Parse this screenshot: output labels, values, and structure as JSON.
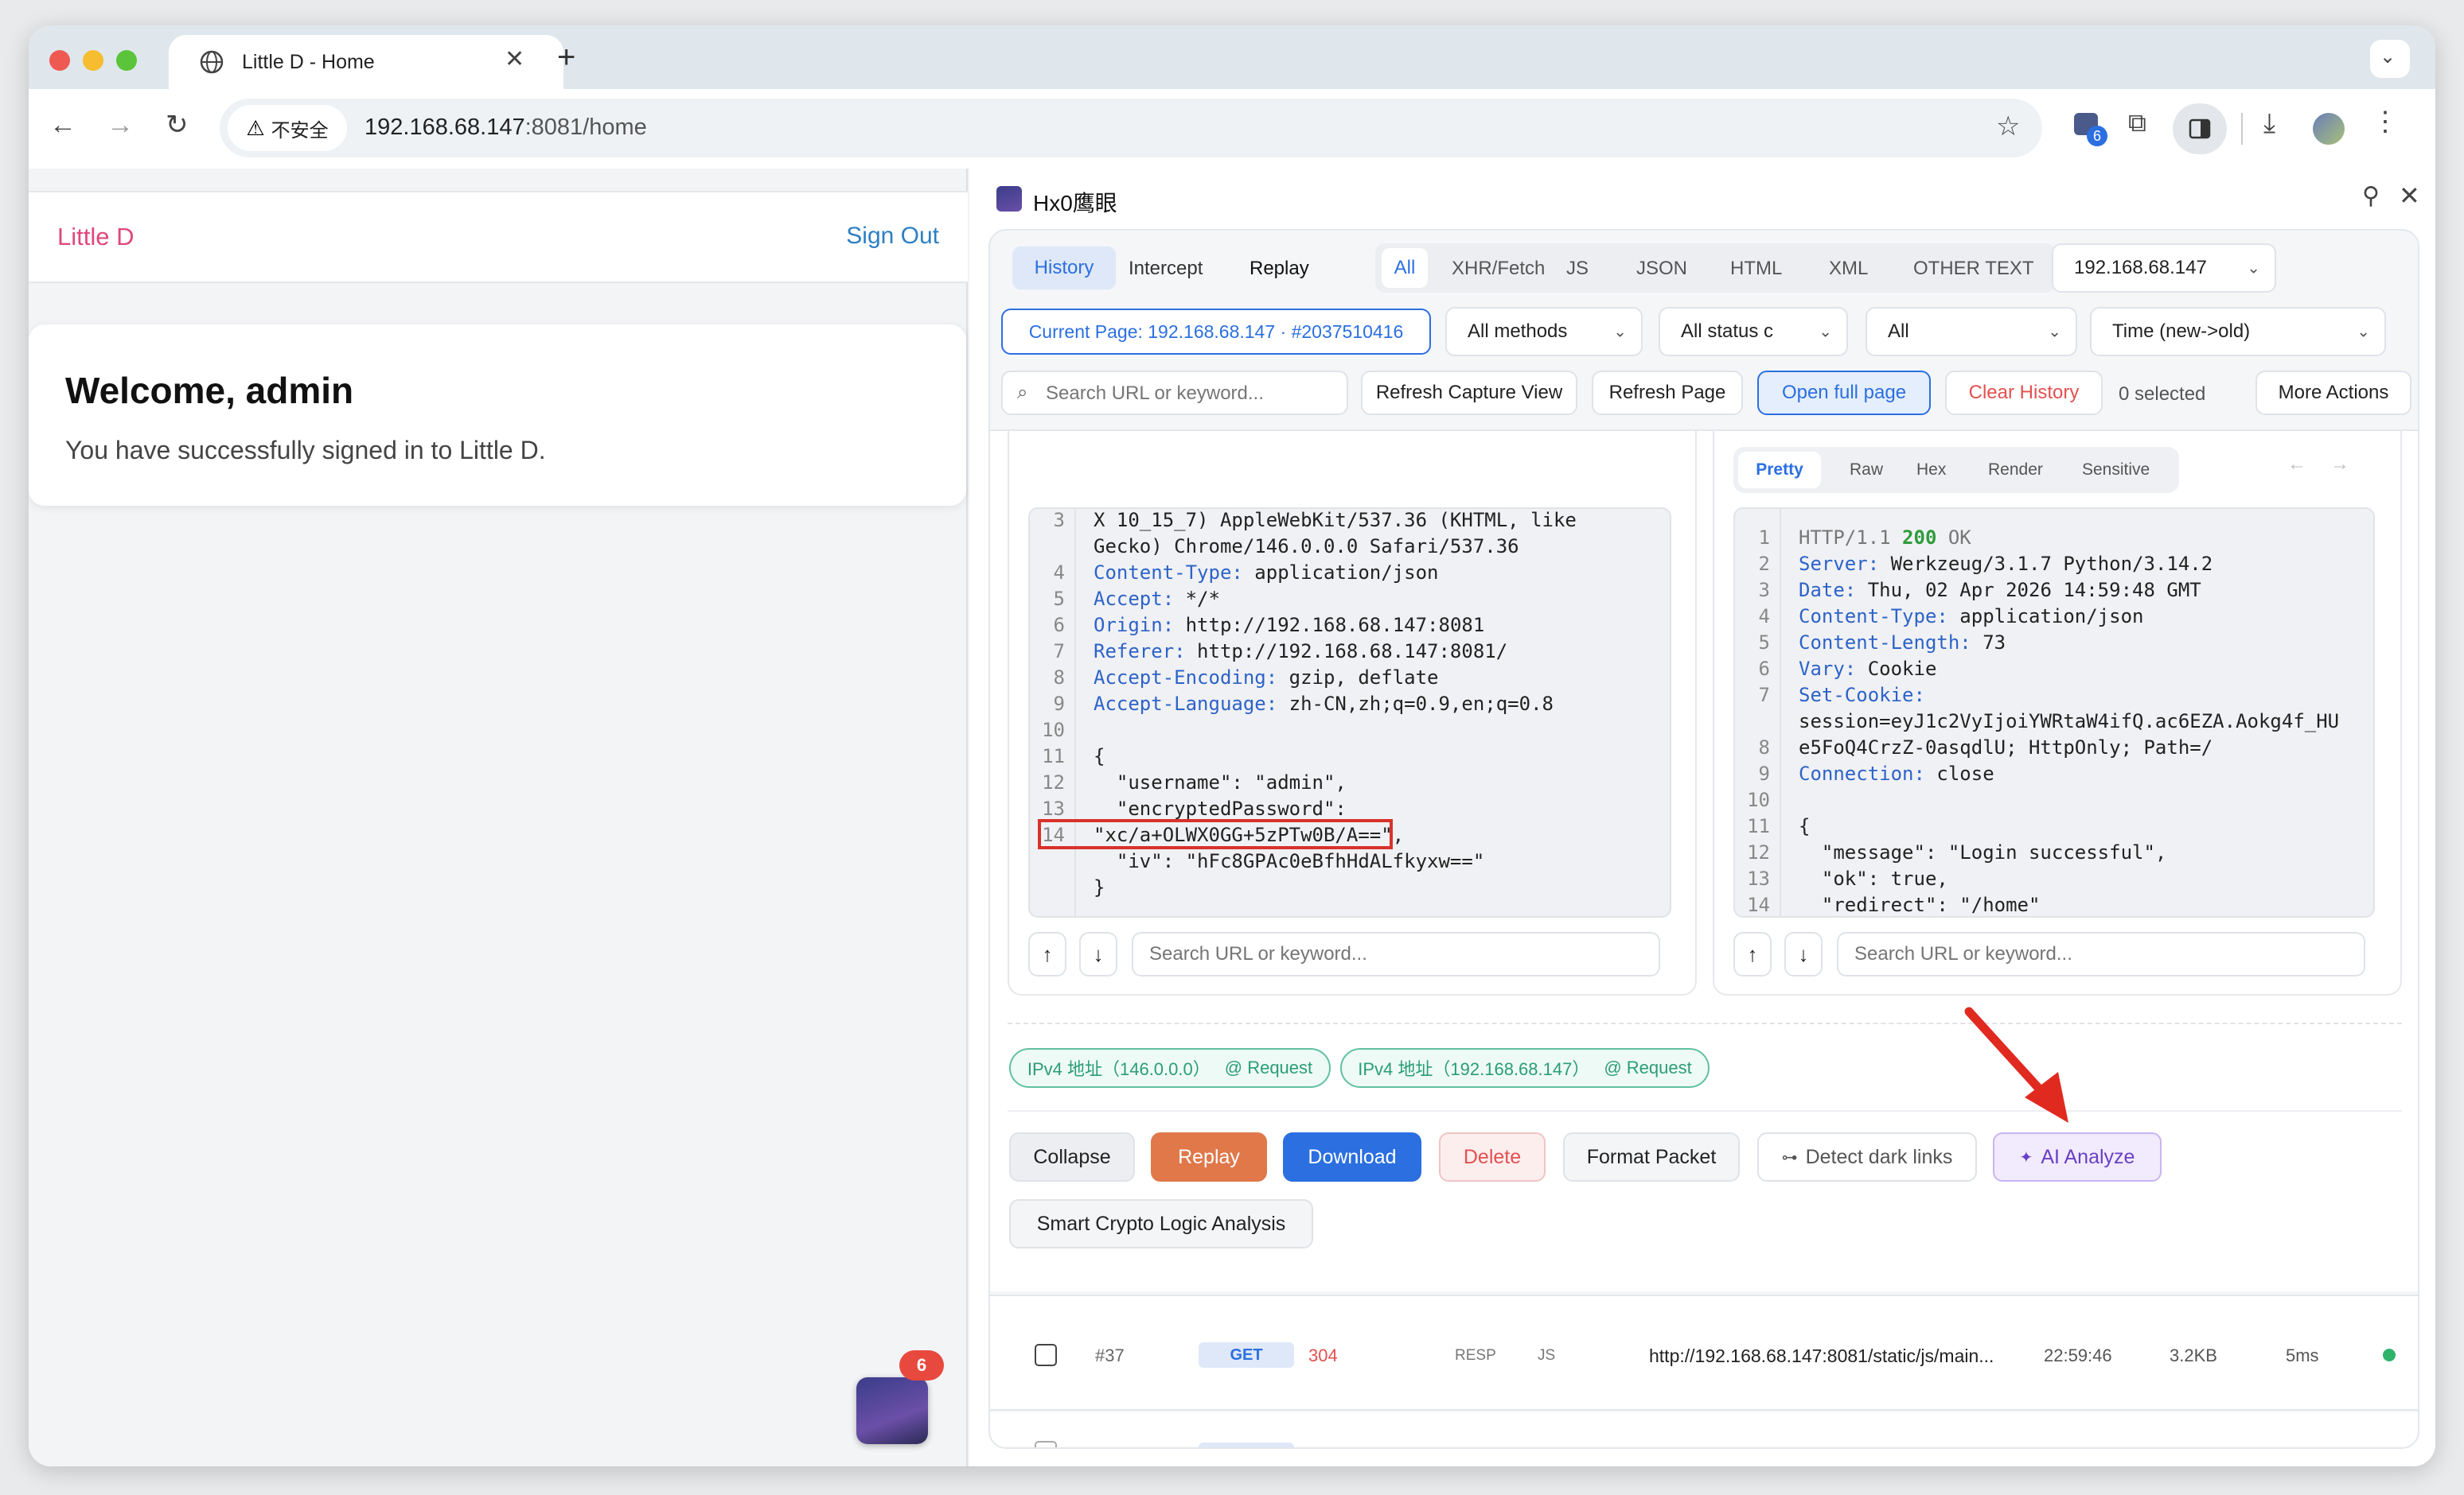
{
  "browser": {
    "tab_title": "Little D - Home",
    "new_tab": "+",
    "security_label": "不安全",
    "url_host": "192.168.68.147",
    "url_rest": ":8081/home",
    "ext_badge": "6"
  },
  "app": {
    "brand": "Little D",
    "sign_out": "Sign Out",
    "welcome_title": "Welcome, admin",
    "welcome_text": "You have successfully signed in to Little D.",
    "float_badge": "6"
  },
  "panel": {
    "title": "Hx0鹰眼",
    "mode_tabs": [
      "History",
      "Intercept",
      "Replay"
    ],
    "type_filters": [
      "All",
      "XHR/Fetch",
      "JS",
      "JSON",
      "HTML",
      "XML",
      "OTHER TEXT"
    ],
    "host_select": "192.168.68.147",
    "current_page": "Current Page: 192.168.68.147 · #2037510416",
    "methods_select": "All methods",
    "status_select": "All status c",
    "all_select": "All",
    "time_select": "Time (new->old)",
    "search_placeholder": "Search URL or keyword...",
    "refresh_capture": "Refresh Capture View",
    "refresh_page": "Refresh Page",
    "open_full_page": "Open full page",
    "clear_history": "Clear History",
    "selected_count": "0 selected",
    "more_actions": "More Actions"
  },
  "request_view": {
    "lines": [
      {
        "n": "3",
        "k": "",
        "v": "X 10_15_7) AppleWebKit/537.36 (KHTML, like"
      },
      {
        "n": "",
        "k": "",
        "v": "Gecko) Chrome/146.0.0.0 Safari/537.36"
      },
      {
        "n": "4",
        "k": "Content-Type:",
        "v": " application/json"
      },
      {
        "n": "5",
        "k": "Accept:",
        "v": " */*"
      },
      {
        "n": "6",
        "k": "Origin:",
        "v": " http://192.168.68.147:8081"
      },
      {
        "n": "7",
        "k": "Referer:",
        "v": " http://192.168.68.147:8081/"
      },
      {
        "n": "8",
        "k": "Accept-Encoding:",
        "v": " gzip, deflate"
      },
      {
        "n": "9",
        "k": "Accept-Language:",
        "v": " zh-CN,zh;q=0.9,en;q=0.8"
      },
      {
        "n": "10",
        "k": "",
        "v": ""
      },
      {
        "n": "11",
        "k": "",
        "v": "{"
      },
      {
        "n": "12",
        "k": "",
        "v": "  \"username\": \"admin\","
      },
      {
        "n": "13",
        "k": "",
        "v": "  \"encryptedPassword\":"
      },
      {
        "n": "14",
        "k": "",
        "v": "\"xc/a+OLWX0GG+5zPTw0B/A==\","
      },
      {
        "n": "",
        "k": "",
        "v": "  \"iv\": \"hFc8GPAc0eBfhHdALfkyxw==\""
      },
      {
        "n": "",
        "k": "",
        "v": "}"
      }
    ],
    "search_placeholder": "Search URL or keyword..."
  },
  "response_view": {
    "tabs": [
      "Pretty",
      "Raw",
      "Hex",
      "Render",
      "Sensitive"
    ],
    "status_line": {
      "proto": "HTTP/1.1 ",
      "code": "200",
      "text": " OK"
    },
    "lines": [
      {
        "n": "2",
        "k": "Server:",
        "v": " Werkzeug/3.1.7 Python/3.14.2"
      },
      {
        "n": "3",
        "k": "Date:",
        "v": " Thu, 02 Apr 2026 14:59:48 GMT"
      },
      {
        "n": "4",
        "k": "Content-Type:",
        "v": " application/json"
      },
      {
        "n": "5",
        "k": "Content-Length:",
        "v": " 73"
      },
      {
        "n": "6",
        "k": "Vary:",
        "v": " Cookie"
      },
      {
        "n": "7",
        "k": "Set-Cookie:",
        "v": ""
      },
      {
        "n": "",
        "k": "",
        "v": "session=eyJ1c2VyIjoiYWRtaW4ifQ.ac6EZA.Aokg4f_HU"
      },
      {
        "n": "8",
        "k": "",
        "v": "e5FoQ4CrzZ-0asqdlU; HttpOnly; Path=/"
      },
      {
        "n": "9",
        "k": "Connection:",
        "v": " close"
      },
      {
        "n": "10",
        "k": "",
        "v": ""
      },
      {
        "n": "11",
        "k": "",
        "v": "{"
      },
      {
        "n": "12",
        "k": "",
        "v": "  \"message\": \"Login successful\","
      },
      {
        "n": "13",
        "k": "",
        "v": "  \"ok\": true,"
      },
      {
        "n": "14",
        "k": "",
        "v": "  \"redirect\": \"/home\""
      }
    ],
    "search_placeholder": "Search URL or keyword..."
  },
  "tags": [
    {
      "label": "IPv4 地址（146.0.0.0）",
      "src": "@ Request"
    },
    {
      "label": "IPv4 地址（192.168.68.147）",
      "src": "@ Request"
    }
  ],
  "actions": {
    "collapse": "Collapse",
    "replay": "Replay",
    "download": "Download",
    "delete": "Delete",
    "format": "Format Packet",
    "detect": "Detect dark links",
    "ai": "AI Analyze",
    "crypto": "Smart Crypto Logic Analysis"
  },
  "history_row": {
    "id": "#37",
    "method": "GET",
    "status": "304",
    "resp": "RESP",
    "type": "JS",
    "url": "http://192.168.68.147:8081/static/js/main...",
    "time": "22:59:46",
    "size": "3.2KB",
    "duration": "5ms"
  },
  "colors": {
    "accent": "#2b6fe0",
    "brand": "#e0497a",
    "replay": "#e0784a",
    "danger": "#e35050",
    "ai": "#7a4ad0"
  }
}
